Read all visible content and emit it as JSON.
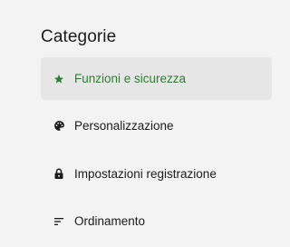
{
  "sidebar": {
    "heading": "Categorie",
    "accent_color": "#2e7d32",
    "items": [
      {
        "label": "Funzioni e sicurezza",
        "icon": "star-icon",
        "selected": true
      },
      {
        "label": "Personalizzazione",
        "icon": "palette-icon",
        "selected": false
      },
      {
        "label": "Impostazioni registrazione",
        "icon": "lock-icon",
        "selected": false
      },
      {
        "label": "Ordinamento",
        "icon": "sort-icon",
        "selected": false
      }
    ]
  }
}
